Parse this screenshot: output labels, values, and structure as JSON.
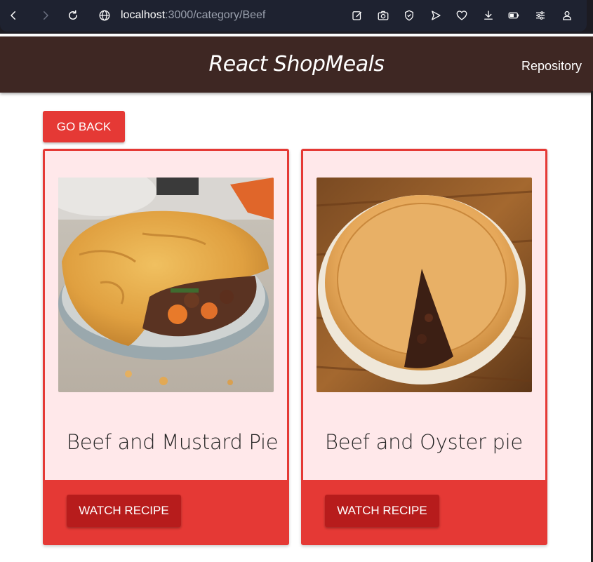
{
  "browser": {
    "url_host": "localhost",
    "url_path": ":3000/category/Beef"
  },
  "header": {
    "title": "React ShopMeals",
    "repo_label": "Repository"
  },
  "actions": {
    "go_back_label": "GO BACK"
  },
  "meals": [
    {
      "name": "Beef and Mustard Pie",
      "button_label": "WATCH RECIPE"
    },
    {
      "name": "Beef and Oyster pie",
      "button_label": "WATCH RECIPE"
    }
  ],
  "colors": {
    "header_bg": "#3e2723",
    "accent": "#e53935",
    "button_dark": "#b71c1c",
    "card_bg": "#ffe8ea"
  }
}
